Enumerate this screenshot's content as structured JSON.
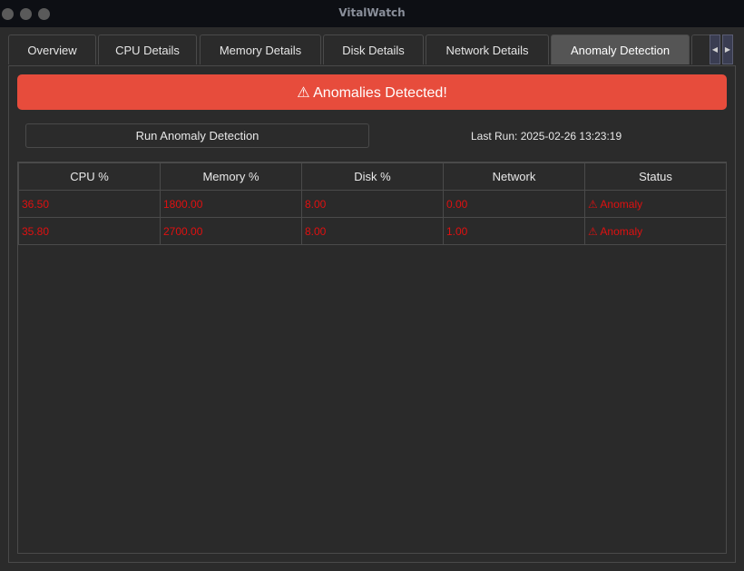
{
  "window": {
    "title": "VitalWatch"
  },
  "tabs": [
    {
      "label": "Overview",
      "active": false
    },
    {
      "label": "CPU Details",
      "active": false
    },
    {
      "label": "Memory Details",
      "active": false
    },
    {
      "label": "Disk Details",
      "active": false
    },
    {
      "label": "Network Details",
      "active": false
    },
    {
      "label": "Anomaly Detection",
      "active": true
    }
  ],
  "tab_scroll": {
    "left_icon": "triangle-left-icon",
    "right_icon": "triangle-right-icon",
    "left_glyph": "◀",
    "right_glyph": "▶"
  },
  "banner": {
    "text": "⚠ Anomalies Detected!",
    "color": "#e74c3c"
  },
  "controls": {
    "run_button_label": "Run Anomaly Detection",
    "last_run": "Last Run: 2025-02-26 13:23:19"
  },
  "table": {
    "headers": [
      "CPU %",
      "Memory %",
      "Disk %",
      "Network",
      "Status"
    ],
    "rows": [
      [
        "36.50",
        "1800.00",
        "8.00",
        "0.00",
        "⚠ Anomaly"
      ],
      [
        "35.80",
        "2700.00",
        "8.00",
        "1.00",
        "⚠ Anomaly"
      ]
    ],
    "row_text_color": "#e01010"
  }
}
